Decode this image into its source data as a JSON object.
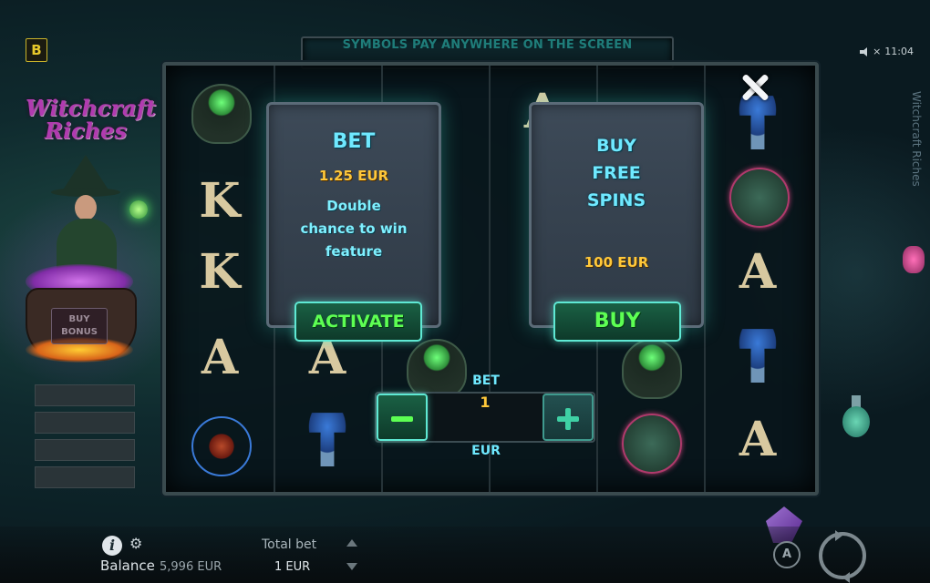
{
  "top": {
    "brand_badge": "B",
    "banner_text": "SYMBOLS PAY ANYWHERE ON THE SCREEN",
    "clock": "11:04",
    "sound_icon": "speaker-muted-icon"
  },
  "game": {
    "logo_line1": "Witchcraft",
    "logo_line2": "Riches",
    "vertical_title": "Witchcraft Riches",
    "buy_bonus_label": "BUY BONUS"
  },
  "panels": {
    "bet": {
      "title": "BET",
      "price": "1.25 EUR",
      "desc_line1": "Double",
      "desc_line2": "chance to win",
      "desc_line3": "feature",
      "button": "ACTIVATE"
    },
    "free_spins": {
      "title_line1": "BUY",
      "title_line2": "FREE",
      "title_line3": "SPINS",
      "price": "100 EUR",
      "button": "BUY"
    }
  },
  "stepper": {
    "label": "BET",
    "value": "1",
    "unit": "EUR"
  },
  "bottom": {
    "balance_label": "Balance",
    "balance_value": "5,996 EUR",
    "total_bet_label": "Total bet",
    "total_bet_value": "1 EUR",
    "auto_label": "A"
  },
  "colors": {
    "accent_cyan": "#6fe9ff",
    "price_gold": "#ffc83a",
    "button_green": "#5dff53",
    "button_border": "#5fe9d4"
  }
}
